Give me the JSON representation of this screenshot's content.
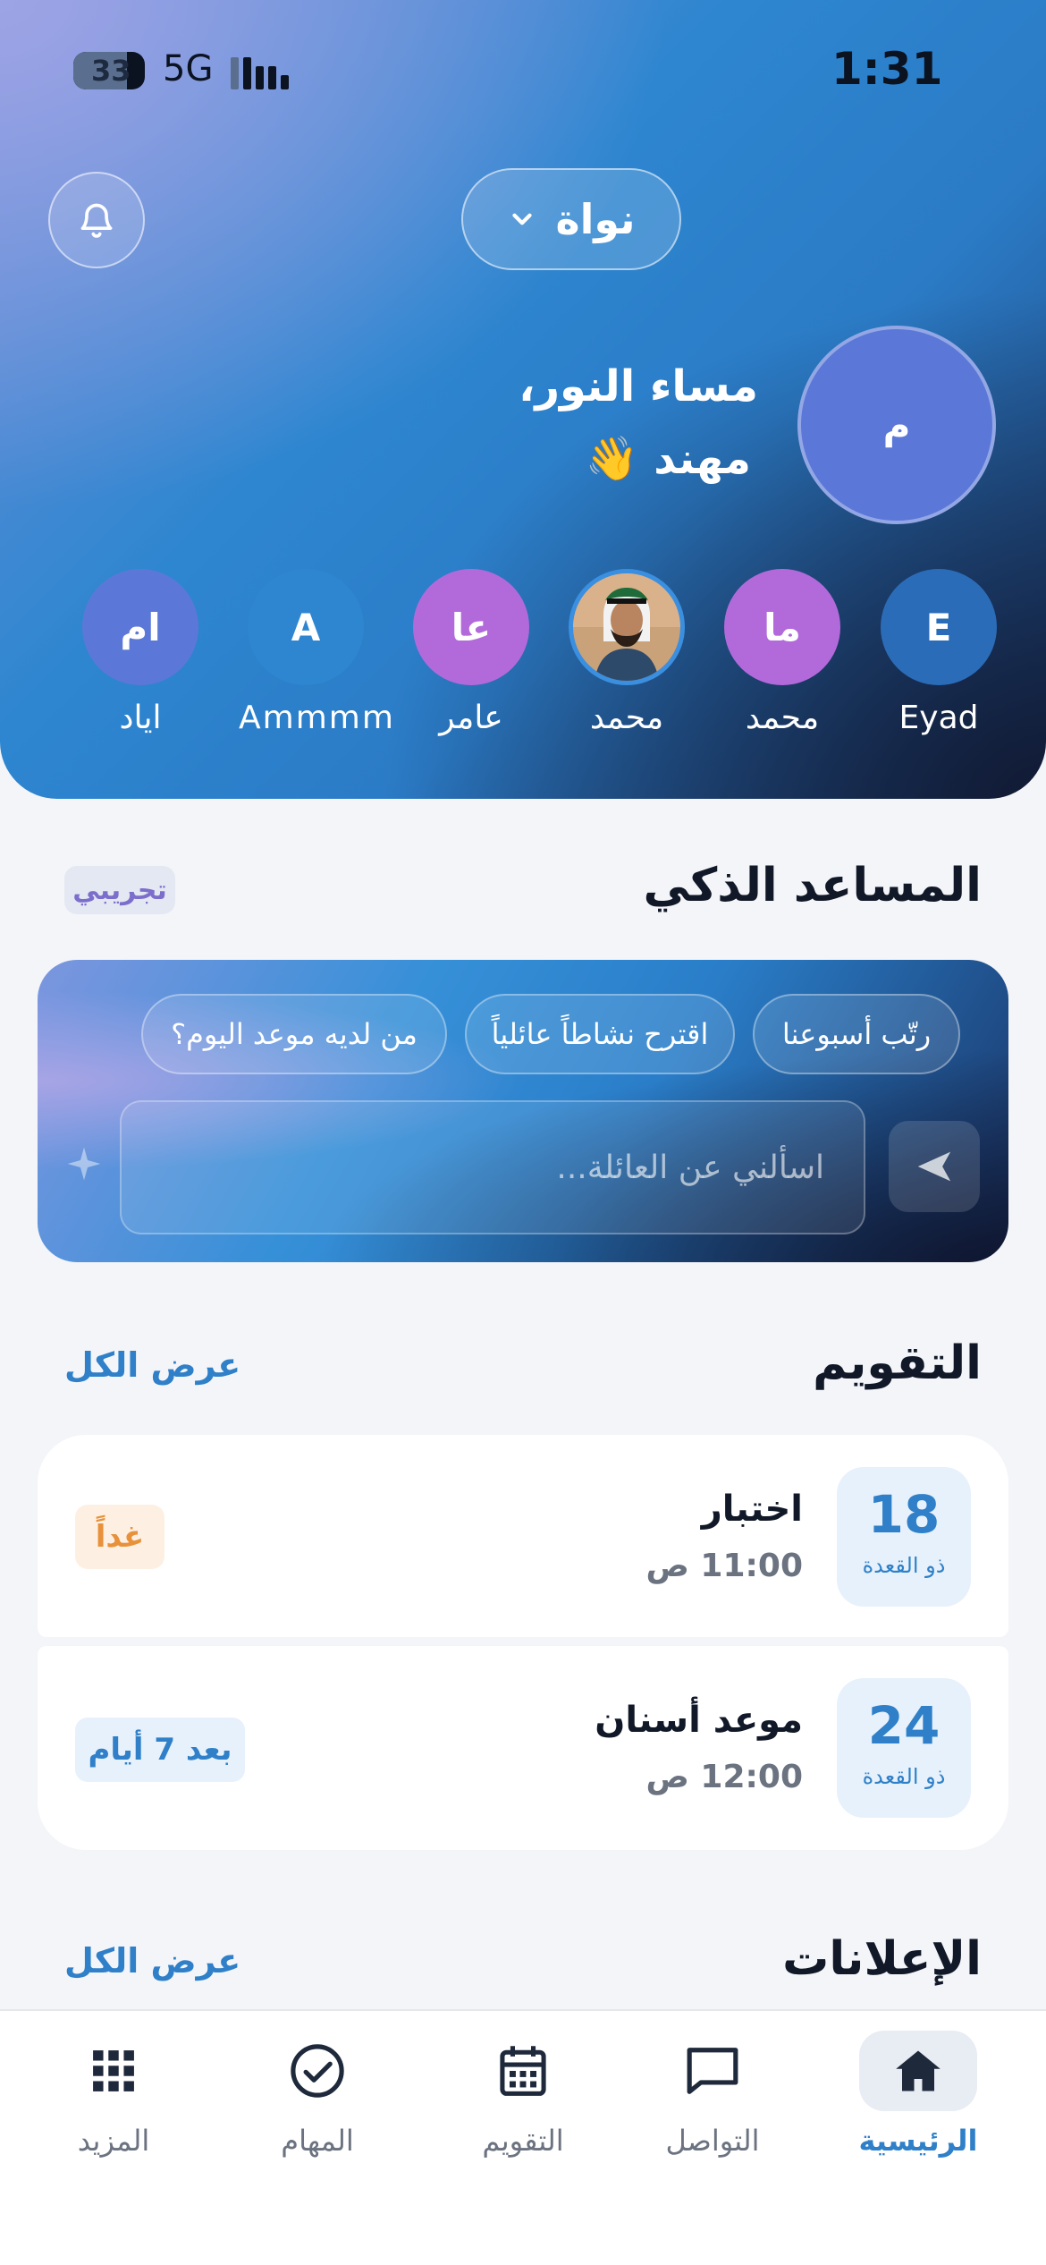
{
  "status_bar": {
    "time": "1:31",
    "battery": "33",
    "network": "5G"
  },
  "header": {
    "family_name": "نواة",
    "greeting_line1": "مساء النور،",
    "greeting_line2": "مهند 👋",
    "user_avatar_initial": "م",
    "members": [
      {
        "initials": "E",
        "name": "Eyad",
        "color": "#2B6CB8"
      },
      {
        "initials": "ما",
        "name": "محمد",
        "color": "#B26ADB"
      },
      {
        "initials": "",
        "name": "محمد",
        "color": "#2B7BC6",
        "photo": true
      },
      {
        "initials": "عا",
        "name": "عامر",
        "color": "#B26ADB"
      },
      {
        "initials": "A",
        "name": "Ammmm",
        "color": "#2F86D0"
      },
      {
        "initials": "ام",
        "name": "اياد",
        "color": "#5B78D8"
      }
    ]
  },
  "assistant": {
    "title": "المساعد الذكي",
    "beta_label": "تجريبي",
    "chips": [
      "رتّب أسبوعنا",
      "اقترح نشاطاً عائلياً",
      "من لديه موعد اليوم؟"
    ],
    "input_placeholder": "اسألني عن العائلة..."
  },
  "calendar": {
    "title": "التقويم",
    "view_all": "عرض الكل",
    "events": [
      {
        "day": "18",
        "month": "ذو القعدة",
        "title": "اختبار",
        "time": "11:00 ص",
        "badge": "غداً",
        "badge_bg": "#FDF0E3",
        "badge_color": "#E8913A"
      },
      {
        "day": "24",
        "month": "ذو القعدة",
        "title": "موعد أسنان",
        "time": "12:00 ص",
        "badge": "بعد 7 أيام",
        "badge_bg": "#E7F1FB",
        "badge_color": "#2F80C8"
      }
    ]
  },
  "announcements": {
    "title": "الإعلانات",
    "view_all": "عرض الكل"
  },
  "tabbar": {
    "items": [
      {
        "label": "الرئيسية",
        "icon": "home-icon",
        "active": true
      },
      {
        "label": "التواصل",
        "icon": "chat-icon",
        "active": false
      },
      {
        "label": "التقويم",
        "icon": "calendar-icon",
        "active": false
      },
      {
        "label": "المهام",
        "icon": "check-circle-icon",
        "active": false
      },
      {
        "label": "المزيد",
        "icon": "grid-icon",
        "active": false
      }
    ]
  }
}
